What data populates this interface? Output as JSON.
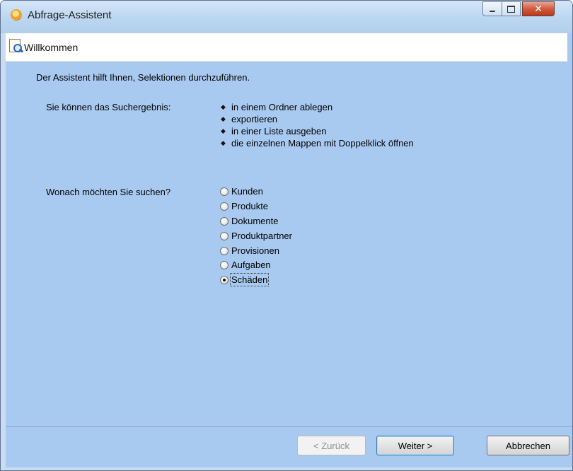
{
  "window": {
    "title": "Abfrage-Assistent",
    "controls": [
      "minimize-icon",
      "maximize-icon",
      "close-icon"
    ]
  },
  "header": {
    "title": "Willkommen"
  },
  "intro": "Der Assistent hilft Ihnen, Selektionen durchzuführen.",
  "result_section": {
    "label": "Sie können das Suchergebnis:",
    "items": [
      "in einem Ordner ablegen",
      "exportieren",
      "in einer Liste ausgeben",
      "die einzelnen Mappen mit Doppelklick öffnen"
    ]
  },
  "search_section": {
    "label": "Wonach möchten Sie suchen?",
    "options": [
      {
        "label": "Kunden",
        "checked": false
      },
      {
        "label": "Produkte",
        "checked": false
      },
      {
        "label": "Dokumente",
        "checked": false
      },
      {
        "label": "Produktpartner",
        "checked": false
      },
      {
        "label": "Provisionen",
        "checked": false
      },
      {
        "label": "Aufgaben",
        "checked": false
      },
      {
        "label": "Schäden",
        "checked": true
      }
    ]
  },
  "buttons": {
    "back": "< Zurück",
    "next": "Weiter >",
    "cancel": "Abbrechen"
  },
  "colors": {
    "accent": "#a9caf0",
    "title_bar": "#bcd6f1"
  }
}
